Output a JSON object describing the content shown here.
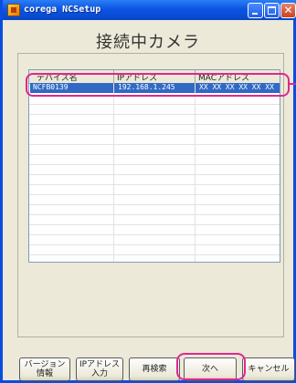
{
  "window": {
    "title": "corega NCSetup",
    "heading": "接続中カメラ"
  },
  "camera_list": {
    "columns": [
      "デバイス名",
      "IPアドレス",
      "MACアドレス"
    ],
    "rows": [
      {
        "device_name": "NCFB0139",
        "ip_address": "192.168.1.245",
        "mac_address": "XX XX XX XX XX XX",
        "selected": true
      }
    ]
  },
  "buttons": {
    "version_info": "バージョン\n情報",
    "ip_address_input": "IPアドレス\n入力",
    "research": "再検索",
    "next": "次へ",
    "cancel": "キャンセル"
  },
  "colors": {
    "title_bar": "#0b55e3",
    "selection": "#316ac5",
    "highlight": "#e0278f"
  }
}
